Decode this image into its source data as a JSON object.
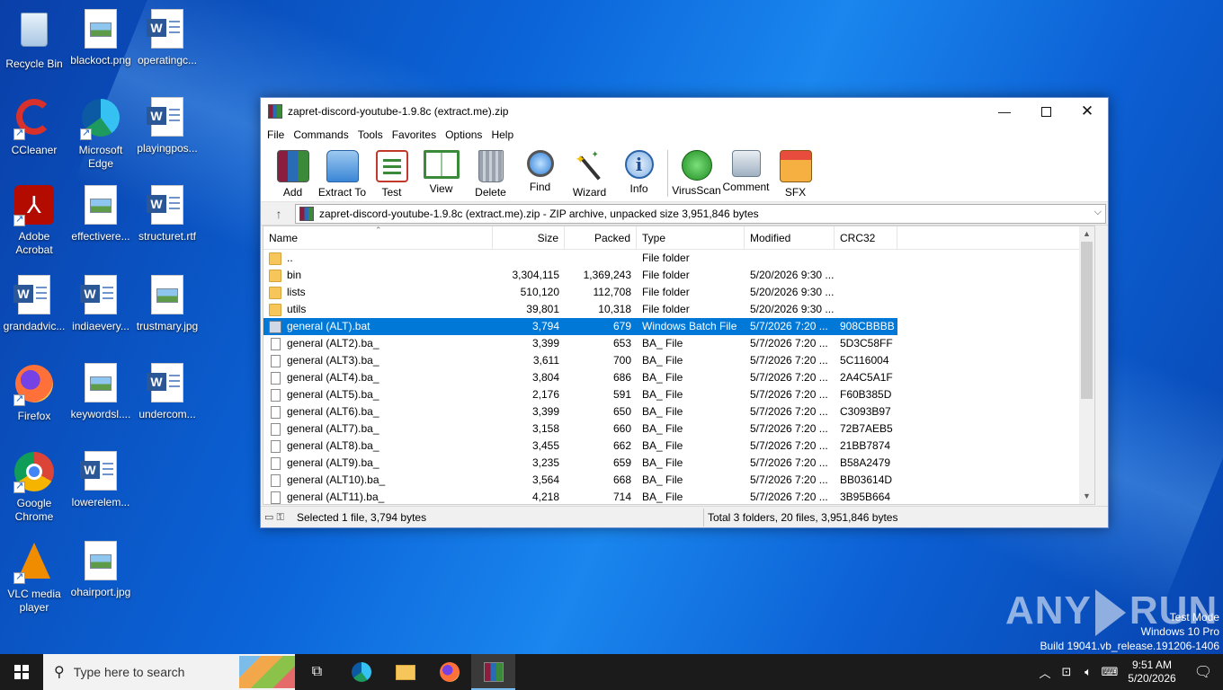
{
  "desktop": {
    "icons": [
      {
        "label": "Recycle Bin"
      },
      {
        "label": "blackoct.png"
      },
      {
        "label": "operatingc..."
      },
      {
        "label": "CCleaner"
      },
      {
        "label": "Microsoft Edge"
      },
      {
        "label": "playingpos..."
      },
      {
        "label": "Adobe Acrobat"
      },
      {
        "label": "effectivere..."
      },
      {
        "label": "structuret.rtf"
      },
      {
        "label": "grandadvic..."
      },
      {
        "label": "indiaevery..."
      },
      {
        "label": "trustmary.jpg"
      },
      {
        "label": "Firefox"
      },
      {
        "label": "keywordsl...."
      },
      {
        "label": "undercom..."
      },
      {
        "label": "Google Chrome"
      },
      {
        "label": "lowerelem..."
      },
      {
        "label": "VLC media player"
      },
      {
        "label": "ohairport.jpg"
      }
    ]
  },
  "window": {
    "title": "zapret-discord-youtube-1.9.8c (extract.me).zip",
    "menu": [
      "File",
      "Commands",
      "Tools",
      "Favorites",
      "Options",
      "Help"
    ],
    "toolbar": [
      "Add",
      "Extract To",
      "Test",
      "View",
      "Delete",
      "Find",
      "Wizard",
      "Info",
      "VirusScan",
      "Comment",
      "SFX"
    ],
    "address": "zapret-discord-youtube-1.9.8c (extract.me).zip - ZIP archive, unpacked size 3,951,846 bytes",
    "columns": [
      "Name",
      "Size",
      "Packed",
      "Type",
      "Modified",
      "CRC32"
    ],
    "rows": [
      {
        "name": "..",
        "size": "",
        "packed": "",
        "type": "File folder",
        "modified": "",
        "crc": "",
        "icon": "folder"
      },
      {
        "name": "bin",
        "size": "3,304,115",
        "packed": "1,369,243",
        "type": "File folder",
        "modified": "5/20/2026 9:30 ...",
        "crc": "",
        "icon": "folder"
      },
      {
        "name": "lists",
        "size": "510,120",
        "packed": "112,708",
        "type": "File folder",
        "modified": "5/20/2026 9:30 ...",
        "crc": "",
        "icon": "folder"
      },
      {
        "name": "utils",
        "size": "39,801",
        "packed": "10,318",
        "type": "File folder",
        "modified": "5/20/2026 9:30 ...",
        "crc": "",
        "icon": "folder"
      },
      {
        "name": "general (ALT).bat",
        "size": "3,794",
        "packed": "679",
        "type": "Windows Batch File",
        "modified": "5/7/2026 7:20 ...",
        "crc": "908CBBBB",
        "icon": "bat",
        "selected": true
      },
      {
        "name": "general (ALT2).ba_",
        "size": "3,399",
        "packed": "653",
        "type": "BA_ File",
        "modified": "5/7/2026 7:20 ...",
        "crc": "5D3C58FF",
        "icon": "doc"
      },
      {
        "name": "general (ALT3).ba_",
        "size": "3,611",
        "packed": "700",
        "type": "BA_ File",
        "modified": "5/7/2026 7:20 ...",
        "crc": "5C116004",
        "icon": "doc"
      },
      {
        "name": "general (ALT4).ba_",
        "size": "3,804",
        "packed": "686",
        "type": "BA_ File",
        "modified": "5/7/2026 7:20 ...",
        "crc": "2A4C5A1F",
        "icon": "doc"
      },
      {
        "name": "general (ALT5).ba_",
        "size": "2,176",
        "packed": "591",
        "type": "BA_ File",
        "modified": "5/7/2026 7:20 ...",
        "crc": "F60B385D",
        "icon": "doc"
      },
      {
        "name": "general (ALT6).ba_",
        "size": "3,399",
        "packed": "650",
        "type": "BA_ File",
        "modified": "5/7/2026 7:20 ...",
        "crc": "C3093B97",
        "icon": "doc"
      },
      {
        "name": "general (ALT7).ba_",
        "size": "3,158",
        "packed": "660",
        "type": "BA_ File",
        "modified": "5/7/2026 7:20 ...",
        "crc": "72B7AEB5",
        "icon": "doc"
      },
      {
        "name": "general (ALT8).ba_",
        "size": "3,455",
        "packed": "662",
        "type": "BA_ File",
        "modified": "5/7/2026 7:20 ...",
        "crc": "21BB7874",
        "icon": "doc"
      },
      {
        "name": "general (ALT9).ba_",
        "size": "3,235",
        "packed": "659",
        "type": "BA_ File",
        "modified": "5/7/2026 7:20 ...",
        "crc": "B58A2479",
        "icon": "doc"
      },
      {
        "name": "general (ALT10).ba_",
        "size": "3,564",
        "packed": "668",
        "type": "BA_ File",
        "modified": "5/7/2026 7:20 ...",
        "crc": "BB03614D",
        "icon": "doc"
      },
      {
        "name": "general (ALT11).ba_",
        "size": "4,218",
        "packed": "714",
        "type": "BA_ File",
        "modified": "5/7/2026 7:20 ...",
        "crc": "3B95B664",
        "icon": "doc"
      }
    ],
    "status_left": "Selected 1 file, 3,794 bytes",
    "status_right": "Total 3 folders, 20 files, 3,951,846 bytes"
  },
  "watermark": {
    "brand_left": "ANY",
    "brand_right": "RUN",
    "test_mode": "Test Mode",
    "edition": "Windows 10 Pro",
    "build": "Build 19041.vb_release.191206-1406"
  },
  "taskbar": {
    "search_placeholder": "Type here to search",
    "time": "9:51 AM",
    "date": "5/20/2026"
  },
  "colors": {
    "selection": "#0078d7",
    "taskbar": "#1b1b1b",
    "desktop_accent": "#0b64d8"
  }
}
